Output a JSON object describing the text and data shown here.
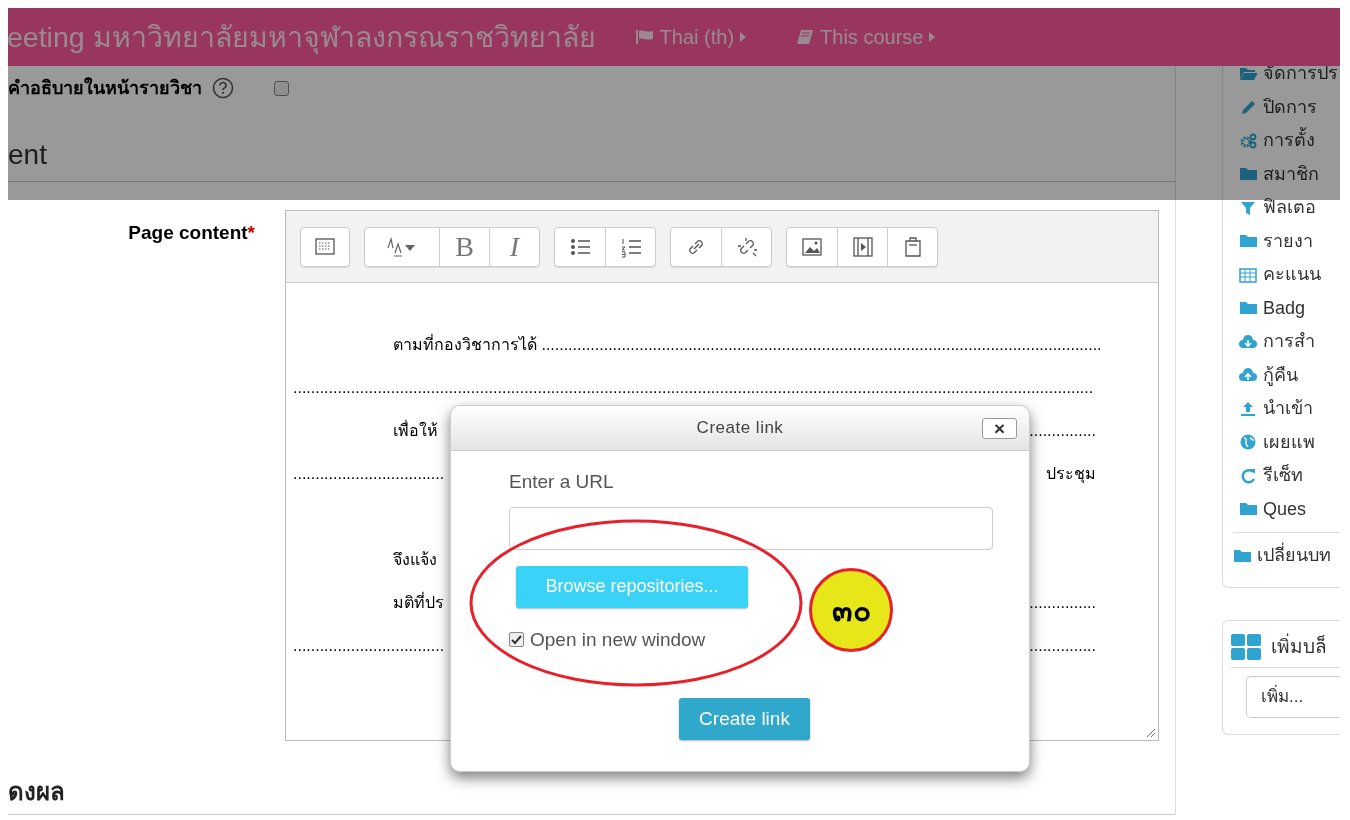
{
  "header": {
    "title": "eeting มหาวิทยาลัยมหาจุฬาลงกรณราชวิทยาลัย",
    "menus": [
      {
        "kind": "flag",
        "label": "Thai (th)"
      },
      {
        "kind": "book",
        "label": "This course"
      }
    ]
  },
  "description_row": {
    "label": "คำอธิบายในหน้ารายวิชา",
    "checked": false
  },
  "section_heading": "ent",
  "field": {
    "label": "Page content",
    "required_mark": "*"
  },
  "toolbar": [
    {
      "buttons": [
        {
          "kind": "toggle"
        }
      ]
    },
    {
      "buttons": [
        {
          "kind": "style"
        },
        {
          "kind": "text",
          "label": "B"
        },
        {
          "kind": "italic",
          "label": "I"
        }
      ]
    },
    {
      "buttons": [
        {
          "kind": "ul"
        },
        {
          "kind": "ol"
        }
      ]
    },
    {
      "buttons": [
        {
          "kind": "link"
        },
        {
          "kind": "unlink"
        }
      ]
    },
    {
      "buttons": [
        {
          "kind": "image"
        },
        {
          "kind": "media"
        },
        {
          "kind": "paste"
        }
      ]
    }
  ],
  "editor_lines": [
    {
      "kind": "indented",
      "left": "ตามที่กองวิชาการได้ .............................................................................................................................."
    },
    {
      "kind": "plain",
      "left": "...................................................................................................................................................................................."
    },
    {
      "kind": "indented",
      "left": "เพื่อให้",
      "right": "..............."
    },
    {
      "kind": "plain",
      "left": "..................................",
      "right": "ประชุม"
    },
    {
      "kind": "indented",
      "left": "จึงแจ้ง"
    },
    {
      "kind": "indented",
      "left": "มติที่ปร",
      "right": "..............."
    },
    {
      "kind": "plain",
      "left": "..................................",
      "right": "..............."
    }
  ],
  "next_heading": "ดงผล",
  "sidebar": {
    "items": [
      {
        "kind": "folder-open",
        "label": "จัดการปร"
      },
      {
        "kind": "pencil",
        "label": "ปิดการ"
      },
      {
        "kind": "gears",
        "label": "การตั้ง"
      },
      {
        "kind": "folder",
        "label": "สมาชิก"
      },
      {
        "kind": "filter",
        "label": "ฟิลเตอ"
      },
      {
        "kind": "folder",
        "label": "รายงา"
      },
      {
        "kind": "table",
        "label": "คะแนน"
      },
      {
        "kind": "folder",
        "label": "Badg"
      },
      {
        "kind": "cloud-down",
        "label": "การสำ"
      },
      {
        "kind": "cloud-up",
        "label": "กู้คืน"
      },
      {
        "kind": "upload",
        "label": "นำเข้า"
      },
      {
        "kind": "globe",
        "label": "เผยแพ"
      },
      {
        "kind": "refresh",
        "label": "รีเซ็ท"
      },
      {
        "kind": "folder",
        "label": "Ques"
      }
    ],
    "footer_item": {
      "kind": "folder",
      "label": "เปลี่ยนบท"
    }
  },
  "add_block": {
    "title": "เพิ่มบล็",
    "select": "เพิ่ม..."
  },
  "dialog": {
    "title": "Create link",
    "close": "×",
    "url_label": "Enter a URL",
    "browse_button": "Browse repositories...",
    "new_window": {
      "label": "Open in new window",
      "checked": true
    },
    "submit": "Create link"
  },
  "annotation": {
    "badge": "๓๐"
  }
}
